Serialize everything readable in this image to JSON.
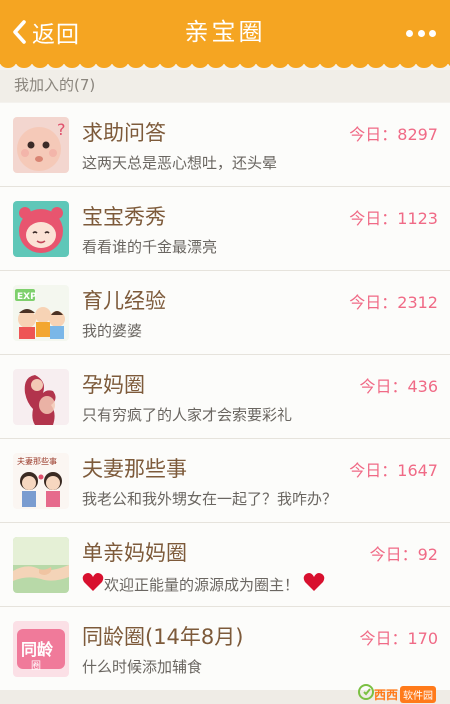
{
  "header": {
    "back_label": "返回",
    "title": "亲宝圈"
  },
  "section": {
    "joined_label": "我加入的(7)"
  },
  "circles": [
    {
      "name": "求助问答",
      "today": "今日：8297",
      "desc": "这两天总是恶心想吐，还头晕",
      "icon": "baby-face-avatar"
    },
    {
      "name": "宝宝秀秀",
      "today": "今日：1123",
      "desc": "看看谁的千金最漂亮",
      "icon": "cartoon-baby-hood-avatar"
    },
    {
      "name": "育儿经验",
      "today": "今日：2312",
      "desc": "我的婆婆",
      "icon": "cartoon-family-avatar"
    },
    {
      "name": "孕妈圈",
      "today": "今日：436",
      "desc": "只有穷疯了的人家才会索要彩礼",
      "icon": "pregnant-mother-avatar"
    },
    {
      "name": "夫妻那些事",
      "today": "今日：1647",
      "desc": "我老公和我外甥女在一起了？我咋办？",
      "icon": "couple-cartoon-avatar"
    },
    {
      "name": "单亲妈妈圈",
      "today": "今日：92",
      "desc": "欢迎正能量的源源成为圈主！",
      "icon": "holding-hands-avatar"
    },
    {
      "name": "同龄圈(14年8月)",
      "today": "今日：170",
      "desc": "什么时候添加辅食",
      "icon": "same-age-badge-avatar"
    }
  ],
  "watermark": {
    "brand": "西西",
    "tag": "软件园"
  },
  "colors": {
    "header_bg": "#f5a522",
    "count_pink": "#f06a86",
    "name_brown": "#7d5a3a"
  }
}
